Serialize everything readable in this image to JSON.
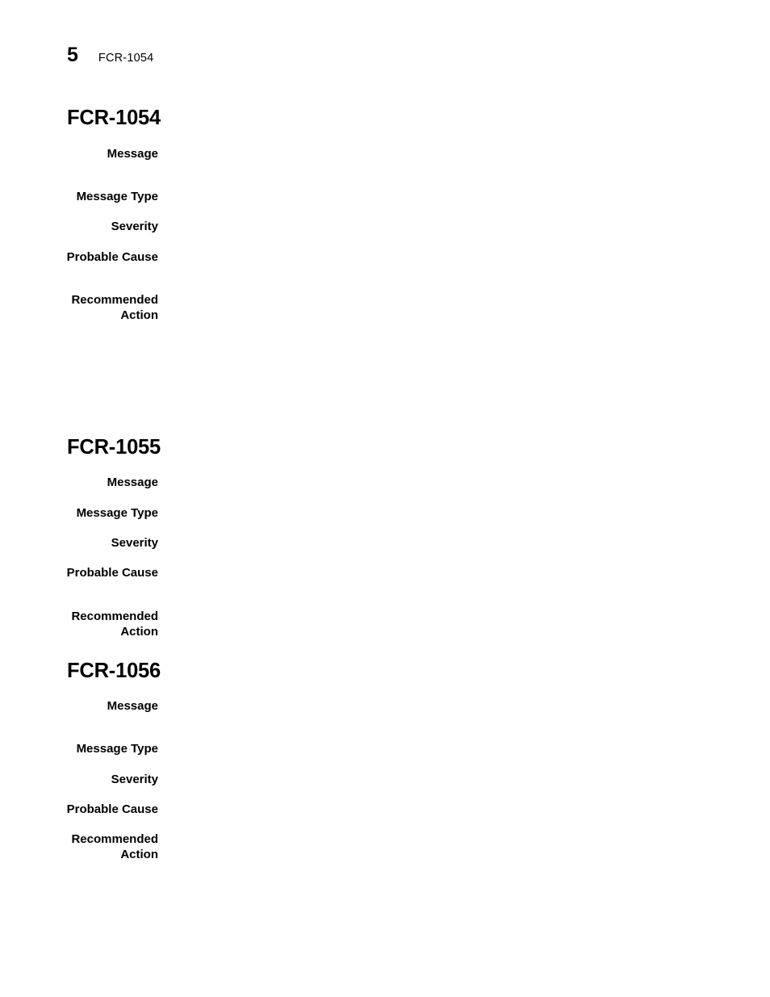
{
  "header": {
    "page_number": "5",
    "chapter_label": "FCR-1054"
  },
  "sections": [
    {
      "heading": "FCR-1054",
      "fields": [
        {
          "label": "Message",
          "value": ""
        },
        {
          "label": "Message Type",
          "value": ""
        },
        {
          "label": "Severity",
          "value": ""
        },
        {
          "label": "Probable Cause",
          "value": ""
        },
        {
          "label": "Recommended\nAction",
          "value": ""
        }
      ]
    },
    {
      "heading": "FCR-1055",
      "fields": [
        {
          "label": "Message",
          "value": ""
        },
        {
          "label": "Message Type",
          "value": ""
        },
        {
          "label": "Severity",
          "value": ""
        },
        {
          "label": "Probable Cause",
          "value": ""
        },
        {
          "label": "Recommended\nAction",
          "value": ""
        }
      ]
    },
    {
      "heading": "FCR-1056",
      "fields": [
        {
          "label": "Message",
          "value": ""
        },
        {
          "label": "Message Type",
          "value": ""
        },
        {
          "label": "Severity",
          "value": ""
        },
        {
          "label": "Probable Cause",
          "value": ""
        },
        {
          "label": "Recommended\nAction",
          "value": ""
        }
      ]
    }
  ]
}
